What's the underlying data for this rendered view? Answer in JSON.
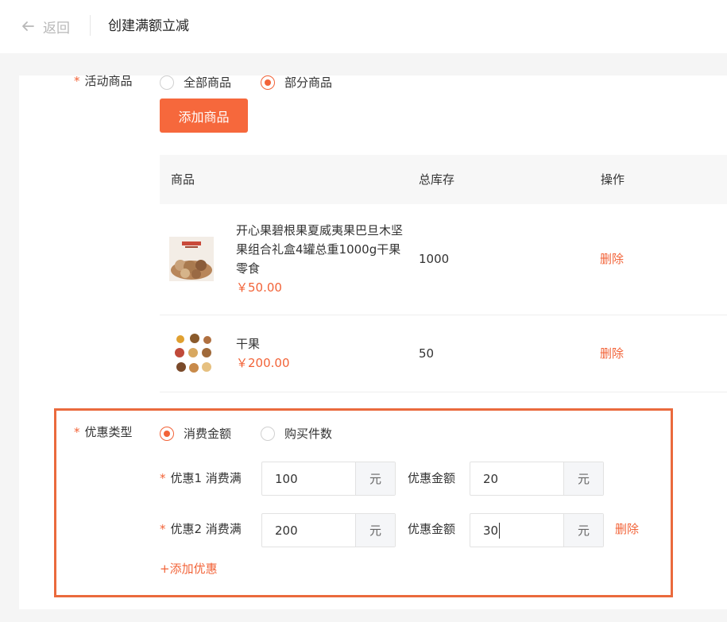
{
  "header": {
    "back_label": "返回",
    "title": "创建满额立减"
  },
  "goods_field": {
    "label": "活动商品",
    "options": [
      {
        "label": "全部商品",
        "selected": false
      },
      {
        "label": "部分商品",
        "selected": true
      }
    ],
    "add_button": "添加商品"
  },
  "table": {
    "columns": [
      "商品",
      "总库存",
      "操作"
    ],
    "rows": [
      {
        "name": "开心果碧根果夏威夷果巴旦木坚果组合礼盒4罐总重1000g干果零食",
        "price": "￥50.00",
        "stock": "1000",
        "action": "删除"
      },
      {
        "name": "干果",
        "price": "￥200.00",
        "stock": "50",
        "action": "删除"
      }
    ]
  },
  "discount_type": {
    "label": "优惠类型",
    "options": [
      {
        "label": "消费金额",
        "selected": true
      },
      {
        "label": "购买件数",
        "selected": false
      }
    ]
  },
  "tiers": [
    {
      "label": "优惠1 消费满",
      "threshold": "100",
      "threshold_unit": "元",
      "amount_label": "优惠金额",
      "amount": "20",
      "amount_unit": "元"
    },
    {
      "label": "优惠2 消费满",
      "threshold": "200",
      "threshold_unit": "元",
      "amount_label": "优惠金额",
      "amount": "30",
      "amount_unit": "元",
      "delete_label": "删除"
    }
  ],
  "add_discount_label": "+添加优惠",
  "colors": {
    "accent": "#f26338",
    "highlight_border": "#ea6a3d"
  }
}
